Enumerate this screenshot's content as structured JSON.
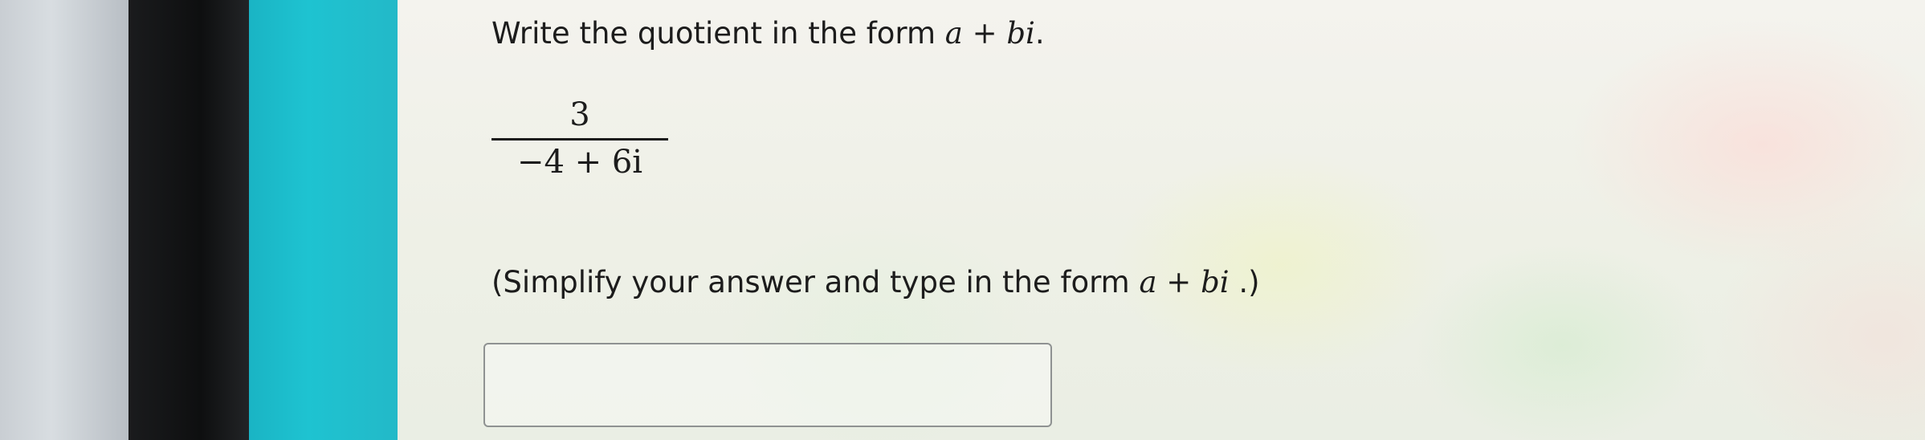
{
  "question": {
    "prefix": "Write the quotient in the form ",
    "form_a": "a",
    "form_op": " + ",
    "form_bi": "bi",
    "suffix": "."
  },
  "fraction": {
    "numerator": "3",
    "denominator": "−4 + 6i"
  },
  "instruction": {
    "prefix": "(Simplify your answer and type in the form ",
    "form_a": "a",
    "form_op": " + ",
    "form_bi": "bi",
    "suffix": " .)"
  },
  "answer": {
    "value": ""
  },
  "colors": {
    "teal_bezel": "#1ec3d1",
    "text": "#1c1c1c"
  }
}
